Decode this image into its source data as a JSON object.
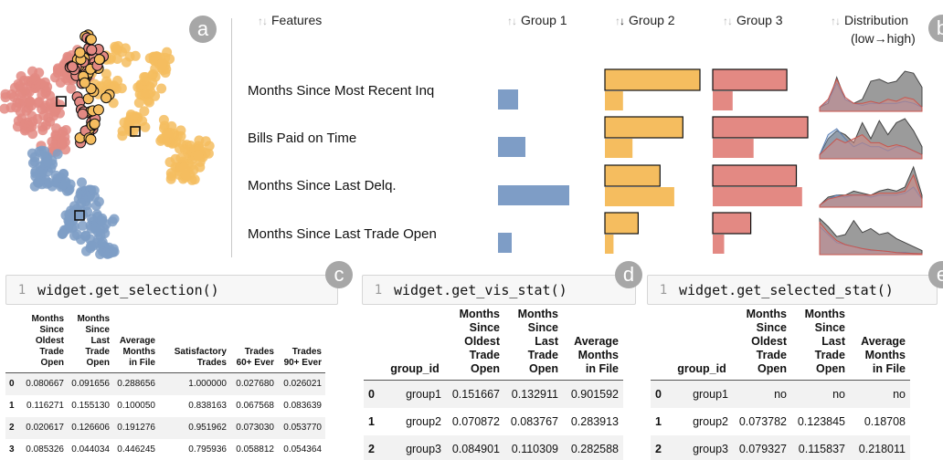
{
  "panels": {
    "scatter_badge": "a",
    "features_badge": "b",
    "selection_badge": "c",
    "vis_stat_badge": "d",
    "selected_stat_badge": "e"
  },
  "features_panel": {
    "headers": {
      "features": "Features",
      "group1": "Group 1",
      "group2": "Group 2",
      "group3": "Group 3",
      "distribution_line1": "Distribution",
      "distribution_line2": "(low→high)"
    },
    "sort_icons": {
      "inactive": "sort-up-down-icon",
      "active": "sort-descending-icon",
      "active_column": "group2"
    },
    "rows": [
      {
        "label": "Months Since Most Recent Inq"
      },
      {
        "label": "Bills Paid on Time"
      },
      {
        "label": "Months Since Last Delq."
      },
      {
        "label": "Months Since Last Trade Open"
      }
    ]
  },
  "chart_data": {
    "type": "bar",
    "categories": [
      "Months Since Most Recent Inq",
      "Bills Paid on Time",
      "Months Since Last Delq.",
      "Months Since Last Trade Open"
    ],
    "series": [
      {
        "name": "Group 1",
        "values": [
          0.22,
          0.3,
          0.78,
          0.15
        ]
      },
      {
        "name": "Group 2",
        "values": [
          1.0,
          0.82,
          0.58,
          0.35
        ],
        "baseline": [
          0.19,
          0.29,
          0.73,
          0.09
        ]
      },
      {
        "name": "Group 3",
        "values": [
          0.78,
          1.0,
          0.88,
          0.4
        ],
        "baseline": [
          0.21,
          0.43,
          0.94,
          0.12
        ]
      }
    ],
    "distribution_sparklines": [
      {
        "selected": [
          0.1,
          0.2,
          0.85,
          0.3,
          0.2,
          0.3,
          0.75,
          0.8,
          0.7,
          0.75,
          1.0,
          0.95,
          0.6
        ],
        "group1": [
          0.1,
          0.25,
          0.7,
          0.3,
          0.2,
          0.15,
          0.2,
          0.2,
          0.2,
          0.2,
          0.25,
          0.2,
          0.1
        ],
        "group3": [
          0.1,
          0.3,
          0.8,
          0.35,
          0.2,
          0.2,
          0.25,
          0.2,
          0.3,
          0.25,
          0.35,
          0.3,
          0.1
        ]
      },
      {
        "selected": [
          0.1,
          0.5,
          0.7,
          0.6,
          0.4,
          0.9,
          0.5,
          0.95,
          0.6,
          0.9,
          1.0,
          0.7,
          0.3
        ],
        "group1": [
          0.1,
          0.6,
          0.75,
          0.5,
          0.3,
          0.4,
          0.3,
          0.3,
          0.2,
          0.3,
          0.3,
          0.2,
          0.1
        ],
        "group3": [
          0.1,
          0.3,
          0.5,
          0.4,
          0.5,
          0.6,
          0.4,
          0.4,
          0.3,
          0.35,
          0.3,
          0.2,
          0.1
        ]
      },
      {
        "selected": [
          0.05,
          0.25,
          0.3,
          0.3,
          0.4,
          0.35,
          0.3,
          0.4,
          0.45,
          0.4,
          0.5,
          1.0,
          0.3
        ],
        "group1": [
          0.05,
          0.2,
          0.3,
          0.25,
          0.3,
          0.3,
          0.25,
          0.3,
          0.3,
          0.3,
          0.35,
          0.5,
          0.2
        ],
        "group3": [
          0.05,
          0.2,
          0.25,
          0.3,
          0.3,
          0.3,
          0.3,
          0.35,
          0.35,
          0.35,
          0.4,
          0.8,
          0.2
        ]
      },
      {
        "selected": [
          0.9,
          0.7,
          0.45,
          0.5,
          0.85,
          0.55,
          0.65,
          0.5,
          0.55,
          0.4,
          0.3,
          0.2,
          0.1
        ],
        "group1": [
          0.7,
          0.5,
          0.3,
          0.25,
          0.2,
          0.15,
          0.1,
          0.1,
          0.08,
          0.05,
          0.05,
          0.03,
          0.02
        ],
        "group3": [
          0.8,
          0.55,
          0.35,
          0.25,
          0.2,
          0.15,
          0.12,
          0.1,
          0.08,
          0.05,
          0.04,
          0.03,
          0.02
        ]
      }
    ]
  },
  "colors": {
    "group1": "#7e9dc6",
    "group2": "#f5bd5f",
    "group3": "#e38983",
    "gray": "#8a8a8a",
    "badge": "#a7a7a7"
  },
  "cells": {
    "selection": {
      "line": "1",
      "code": "widget.get_selection()"
    },
    "vis_stat": {
      "line": "1",
      "code": "widget.get_vis_stat()"
    },
    "selected_stat": {
      "line": "1",
      "code": "widget.get_selected_stat()"
    }
  },
  "selection_table": {
    "headers": [
      [
        "",
        ""
      ],
      [
        "Months",
        "Since",
        "Oldest",
        "Trade",
        "Open"
      ],
      [
        "Months",
        "Since",
        "Last",
        "Trade",
        "Open"
      ],
      [
        "Average",
        "Months",
        "in File"
      ],
      [
        "Satisfactory",
        "Trades"
      ],
      [
        "Trades",
        "60+ Ever"
      ],
      [
        "Trades",
        "90+ Ever"
      ]
    ],
    "rows": [
      [
        "0",
        "0.080667",
        "0.091656",
        "0.288656",
        "1.000000",
        "0.027680",
        "0.026021"
      ],
      [
        "1",
        "0.116271",
        "0.155130",
        "0.100050",
        "0.838163",
        "0.067568",
        "0.083639"
      ],
      [
        "2",
        "0.020617",
        "0.126606",
        "0.191276",
        "0.951962",
        "0.073030",
        "0.053770"
      ],
      [
        "3",
        "0.085326",
        "0.044034",
        "0.446245",
        "0.795936",
        "0.058812",
        "0.054364"
      ]
    ]
  },
  "vis_stat_table": {
    "headers": [
      [
        ""
      ],
      [
        "group_id"
      ],
      [
        "Months",
        "Since",
        "Oldest",
        "Trade",
        "Open"
      ],
      [
        "Months",
        "Since",
        "Last",
        "Trade",
        "Open"
      ],
      [
        "Average",
        "Months",
        "in File"
      ]
    ],
    "rows": [
      [
        "0",
        "group1",
        "0.151667",
        "0.132911",
        "0.901592"
      ],
      [
        "1",
        "group2",
        "0.070872",
        "0.083767",
        "0.283913"
      ],
      [
        "2",
        "group3",
        "0.084901",
        "0.110309",
        "0.282588"
      ]
    ]
  },
  "selected_stat_table": {
    "headers": [
      [
        ""
      ],
      [
        "group_id"
      ],
      [
        "Months",
        "Since",
        "Oldest",
        "Trade",
        "Open"
      ],
      [
        "Months",
        "Since",
        "Last",
        "Trade",
        "Open"
      ],
      [
        "Average",
        "Months",
        "in File"
      ]
    ],
    "rows": [
      [
        "0",
        "group1",
        "no",
        "no",
        "no"
      ],
      [
        "1",
        "group2",
        "0.073782",
        "0.123845",
        "0.18708"
      ],
      [
        "2",
        "group3",
        "0.079327",
        "0.115837",
        "0.218011"
      ]
    ]
  }
}
